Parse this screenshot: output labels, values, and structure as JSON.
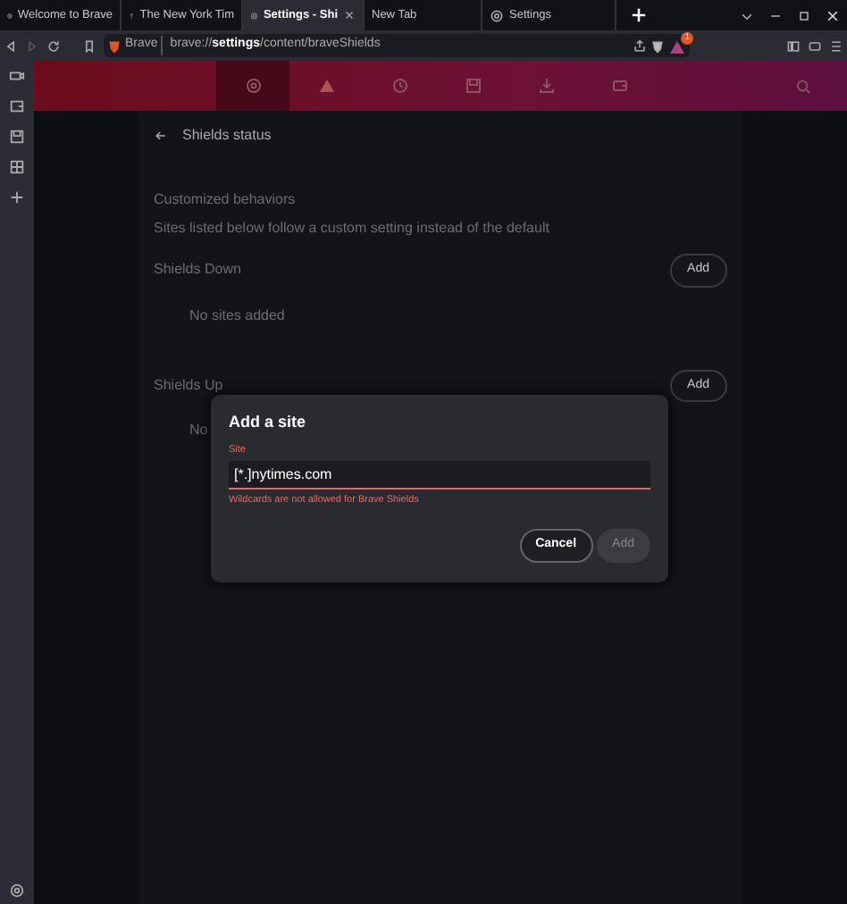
{
  "tabs": [
    {
      "label": "Welcome to Brave",
      "selected": false
    },
    {
      "label": "The New York Tim",
      "selected": false
    },
    {
      "label": "Settings - Shi",
      "selected": true,
      "closable": true
    },
    {
      "label": "New Tab",
      "selected": false
    },
    {
      "label": "Settings",
      "selected": false
    }
  ],
  "address": {
    "site_label": "Brave",
    "url_prefix": "brave://",
    "url_bold": "settings",
    "url_rest": "/content/braveShields",
    "notification_count": "1"
  },
  "settings_nav": [
    {
      "selected": true
    },
    {
      "selected": false
    },
    {
      "selected": false
    },
    {
      "selected": false
    },
    {
      "selected": false
    },
    {
      "selected": false
    }
  ],
  "page": {
    "title": "Shields status",
    "section_title": "Customized behaviors",
    "section_hint": "Sites listed below follow a custom setting instead of the default",
    "lists": [
      {
        "title": "Shields Down",
        "button": "Add",
        "empty": "No sites added"
      },
      {
        "title": "Shields Up",
        "button": "Add",
        "empty": "No"
      }
    ]
  },
  "dialog": {
    "title": "Add a site",
    "field_label": "Site",
    "value": "[*.]nytimes.com",
    "invalid": true,
    "error": "Wildcards are not allowed for Brave Shields",
    "buttons": [
      {
        "label": "Cancel",
        "disabled": false
      },
      {
        "label": "Add",
        "disabled": true
      }
    ]
  }
}
